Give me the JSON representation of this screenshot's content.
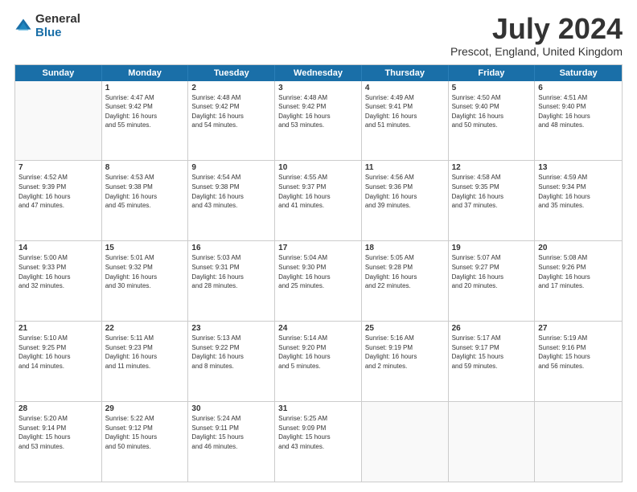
{
  "logo": {
    "general": "General",
    "blue": "Blue"
  },
  "title": "July 2024",
  "subtitle": "Prescot, England, United Kingdom",
  "headers": [
    "Sunday",
    "Monday",
    "Tuesday",
    "Wednesday",
    "Thursday",
    "Friday",
    "Saturday"
  ],
  "rows": [
    [
      {
        "day": "",
        "info": ""
      },
      {
        "day": "1",
        "info": "Sunrise: 4:47 AM\nSunset: 9:42 PM\nDaylight: 16 hours\nand 55 minutes."
      },
      {
        "day": "2",
        "info": "Sunrise: 4:48 AM\nSunset: 9:42 PM\nDaylight: 16 hours\nand 54 minutes."
      },
      {
        "day": "3",
        "info": "Sunrise: 4:48 AM\nSunset: 9:42 PM\nDaylight: 16 hours\nand 53 minutes."
      },
      {
        "day": "4",
        "info": "Sunrise: 4:49 AM\nSunset: 9:41 PM\nDaylight: 16 hours\nand 51 minutes."
      },
      {
        "day": "5",
        "info": "Sunrise: 4:50 AM\nSunset: 9:40 PM\nDaylight: 16 hours\nand 50 minutes."
      },
      {
        "day": "6",
        "info": "Sunrise: 4:51 AM\nSunset: 9:40 PM\nDaylight: 16 hours\nand 48 minutes."
      }
    ],
    [
      {
        "day": "7",
        "info": "Sunrise: 4:52 AM\nSunset: 9:39 PM\nDaylight: 16 hours\nand 47 minutes."
      },
      {
        "day": "8",
        "info": "Sunrise: 4:53 AM\nSunset: 9:38 PM\nDaylight: 16 hours\nand 45 minutes."
      },
      {
        "day": "9",
        "info": "Sunrise: 4:54 AM\nSunset: 9:38 PM\nDaylight: 16 hours\nand 43 minutes."
      },
      {
        "day": "10",
        "info": "Sunrise: 4:55 AM\nSunset: 9:37 PM\nDaylight: 16 hours\nand 41 minutes."
      },
      {
        "day": "11",
        "info": "Sunrise: 4:56 AM\nSunset: 9:36 PM\nDaylight: 16 hours\nand 39 minutes."
      },
      {
        "day": "12",
        "info": "Sunrise: 4:58 AM\nSunset: 9:35 PM\nDaylight: 16 hours\nand 37 minutes."
      },
      {
        "day": "13",
        "info": "Sunrise: 4:59 AM\nSunset: 9:34 PM\nDaylight: 16 hours\nand 35 minutes."
      }
    ],
    [
      {
        "day": "14",
        "info": "Sunrise: 5:00 AM\nSunset: 9:33 PM\nDaylight: 16 hours\nand 32 minutes."
      },
      {
        "day": "15",
        "info": "Sunrise: 5:01 AM\nSunset: 9:32 PM\nDaylight: 16 hours\nand 30 minutes."
      },
      {
        "day": "16",
        "info": "Sunrise: 5:03 AM\nSunset: 9:31 PM\nDaylight: 16 hours\nand 28 minutes."
      },
      {
        "day": "17",
        "info": "Sunrise: 5:04 AM\nSunset: 9:30 PM\nDaylight: 16 hours\nand 25 minutes."
      },
      {
        "day": "18",
        "info": "Sunrise: 5:05 AM\nSunset: 9:28 PM\nDaylight: 16 hours\nand 22 minutes."
      },
      {
        "day": "19",
        "info": "Sunrise: 5:07 AM\nSunset: 9:27 PM\nDaylight: 16 hours\nand 20 minutes."
      },
      {
        "day": "20",
        "info": "Sunrise: 5:08 AM\nSunset: 9:26 PM\nDaylight: 16 hours\nand 17 minutes."
      }
    ],
    [
      {
        "day": "21",
        "info": "Sunrise: 5:10 AM\nSunset: 9:25 PM\nDaylight: 16 hours\nand 14 minutes."
      },
      {
        "day": "22",
        "info": "Sunrise: 5:11 AM\nSunset: 9:23 PM\nDaylight: 16 hours\nand 11 minutes."
      },
      {
        "day": "23",
        "info": "Sunrise: 5:13 AM\nSunset: 9:22 PM\nDaylight: 16 hours\nand 8 minutes."
      },
      {
        "day": "24",
        "info": "Sunrise: 5:14 AM\nSunset: 9:20 PM\nDaylight: 16 hours\nand 5 minutes."
      },
      {
        "day": "25",
        "info": "Sunrise: 5:16 AM\nSunset: 9:19 PM\nDaylight: 16 hours\nand 2 minutes."
      },
      {
        "day": "26",
        "info": "Sunrise: 5:17 AM\nSunset: 9:17 PM\nDaylight: 15 hours\nand 59 minutes."
      },
      {
        "day": "27",
        "info": "Sunrise: 5:19 AM\nSunset: 9:16 PM\nDaylight: 15 hours\nand 56 minutes."
      }
    ],
    [
      {
        "day": "28",
        "info": "Sunrise: 5:20 AM\nSunset: 9:14 PM\nDaylight: 15 hours\nand 53 minutes."
      },
      {
        "day": "29",
        "info": "Sunrise: 5:22 AM\nSunset: 9:12 PM\nDaylight: 15 hours\nand 50 minutes."
      },
      {
        "day": "30",
        "info": "Sunrise: 5:24 AM\nSunset: 9:11 PM\nDaylight: 15 hours\nand 46 minutes."
      },
      {
        "day": "31",
        "info": "Sunrise: 5:25 AM\nSunset: 9:09 PM\nDaylight: 15 hours\nand 43 minutes."
      },
      {
        "day": "",
        "info": ""
      },
      {
        "day": "",
        "info": ""
      },
      {
        "day": "",
        "info": ""
      }
    ]
  ]
}
